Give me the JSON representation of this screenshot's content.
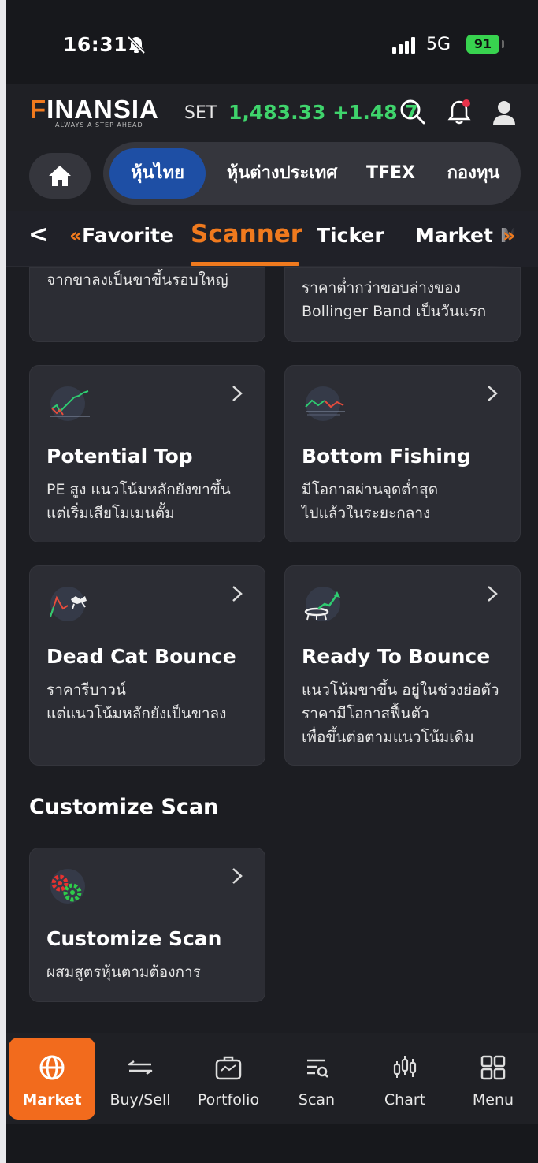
{
  "status": {
    "time": "16:31",
    "network": "5G",
    "battery": "91"
  },
  "header": {
    "logo": "INANSIA",
    "logo_f": "F",
    "tagline": "ALWAYS A STEP AHEAD",
    "index_label": "SET",
    "index_value": "1,483.33 +1.48 7"
  },
  "categories": {
    "tabs": [
      {
        "label": "หุ้นไทย"
      },
      {
        "label": "หุ้นต่างประเทศ"
      },
      {
        "label": "TFEX"
      },
      {
        "label": "กองทุน"
      }
    ]
  },
  "subnav": {
    "items": [
      {
        "label": "Favorite",
        "prefix": "«"
      },
      {
        "label": "Scanner"
      },
      {
        "label": "Ticker"
      },
      {
        "label": "Market M",
        "suffix": "»"
      }
    ]
  },
  "cards": [
    {
      "title": "",
      "desc1": "จากขาลงเป็นขาขึ้นรอบใหญ่",
      "desc2": "",
      "desc3": ""
    },
    {
      "title": "",
      "desc1": "ราคาต่ำกว่าขอบล่างของ",
      "desc2": "Bollinger Band เป็นวันแรก",
      "desc3": ""
    },
    {
      "title": "Potential Top",
      "desc1": "PE สูง แนวโน้มหลักยังขาขึ้น",
      "desc2": "แต่เริ่มเสียโมเมนตั้ม",
      "desc3": ""
    },
    {
      "title": "Bottom Fishing",
      "desc1": "มีโอกาสผ่านจุดต่ำสุด",
      "desc2": "ไปแล้วในระยะกลาง",
      "desc3": ""
    },
    {
      "title": "Dead Cat Bounce",
      "desc1": "ราคารีบาวน์",
      "desc2": "แต่แนวโน้มหลักยังเป็นขาลง",
      "desc3": ""
    },
    {
      "title": "Ready To Bounce",
      "desc1": "แนวโน้มขาขึ้น อยู่ในช่วงย่อตัว",
      "desc2": "ราคามีโอกาสฟื้นตัว",
      "desc3": "เพื่อขึ้นต่อตามแนวโน้มเดิม"
    }
  ],
  "section": {
    "title": "Customize Scan"
  },
  "custom_card": {
    "title": "Customize Scan",
    "desc1": "ผสมสูตรหุ้นตามต้องการ"
  },
  "bottom_nav": {
    "items": [
      {
        "label": "Market",
        "icon": "globe-icon"
      },
      {
        "label": "Buy/Sell",
        "icon": "swap-arrows-icon"
      },
      {
        "label": "Portfolio",
        "icon": "briefcase-icon"
      },
      {
        "label": "Scan",
        "icon": "scan-list-icon"
      },
      {
        "label": "Chart",
        "icon": "candlestick-icon"
      },
      {
        "label": "Menu",
        "icon": "grid-icon"
      }
    ]
  },
  "colors": {
    "accent": "#f07a1e",
    "positive": "#3fd46c",
    "tab_active": "#1e4fa5",
    "nav_active": "#f26b1d"
  }
}
